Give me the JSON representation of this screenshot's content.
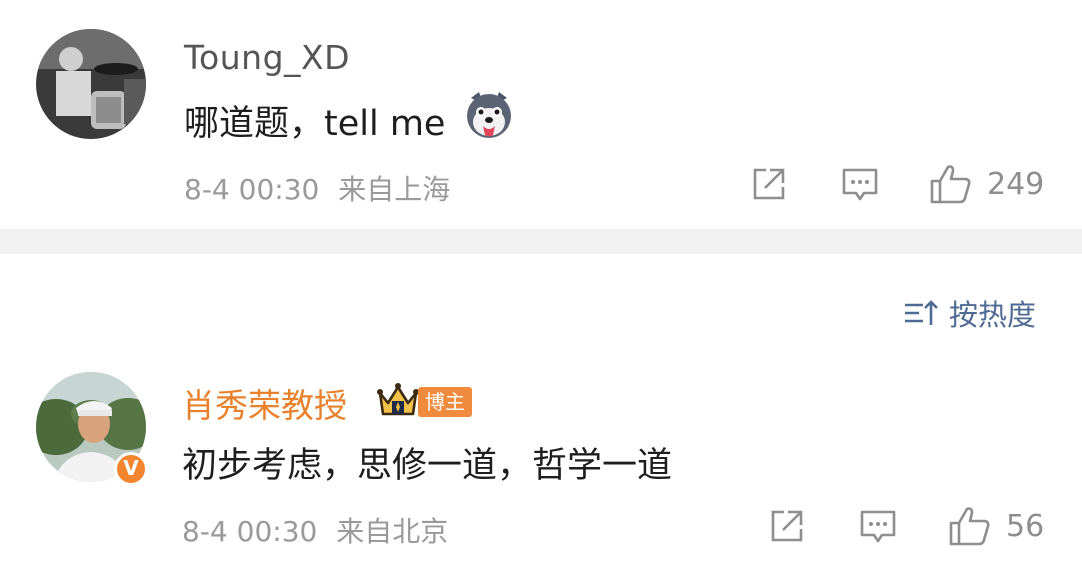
{
  "comments": [
    {
      "username": "Toung_XD",
      "text": "哪道题，tell me",
      "emoji": "husky-emoji",
      "time": "8-4 00:30",
      "location": "来自上海",
      "likes": "249"
    },
    {
      "username": "肖秀荣教授",
      "badge": "博主",
      "crown": "crown-icon",
      "verified": "V",
      "text": "初步考虑，思修一道，哲学一道",
      "time": "8-4 00:30",
      "location": "来自北京",
      "likes": "56"
    }
  ],
  "sort": {
    "label": "按热度"
  },
  "colors": {
    "vip_name": "#e8812c",
    "badge": "#f08a3c",
    "sort": "#4f6a93",
    "divider": "#f1f1f1"
  }
}
